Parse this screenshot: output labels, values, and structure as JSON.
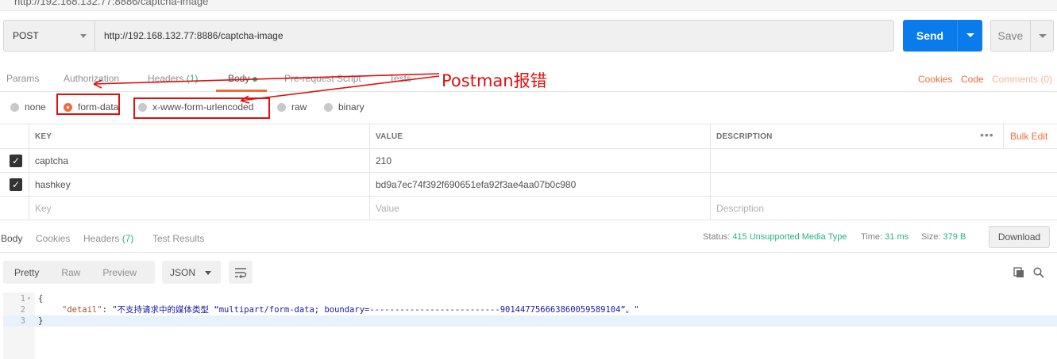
{
  "top_url": "http://192.168.132.77:8886/captcha-image",
  "request": {
    "method": "POST",
    "url": "http://192.168.132.77:8886/captcha-image",
    "send_label": "Send",
    "save_label": "Save"
  },
  "request_tabs": [
    {
      "label": "Params"
    },
    {
      "label": "Authorization"
    },
    {
      "label": "Headers",
      "count": "(1)"
    },
    {
      "label": "Body"
    },
    {
      "label": "Pre-request Script"
    },
    {
      "label": "Tests"
    }
  ],
  "request_right": {
    "cookies": "Cookies",
    "code": "Code",
    "comments": "Comments (0)"
  },
  "body_types": [
    "none",
    "form-data",
    "x-www-form-urlencoded",
    "raw",
    "binary"
  ],
  "selected_body_type": "form-data",
  "params_table": {
    "headers": [
      "KEY",
      "VALUE",
      "DESCRIPTION"
    ],
    "bulk_edit": "Bulk Edit",
    "more": "•••",
    "rows": [
      {
        "key": "captcha",
        "value": "210",
        "description": ""
      },
      {
        "key": "hashkey",
        "value": "bd9a7ec74f392f690651efa92f3ae4aa07b0c980",
        "description": ""
      }
    ],
    "placeholders": {
      "key": "Key",
      "value": "Value",
      "description": "Description"
    }
  },
  "response_tabs": [
    {
      "label": "Body"
    },
    {
      "label": "Cookies"
    },
    {
      "label": "Headers",
      "count": "(7)"
    },
    {
      "label": "Test Results"
    }
  ],
  "response_status": {
    "status_label": "Status:",
    "status_value": "415 Unsupported Media Type",
    "time_label": "Time:",
    "time_value": "31 ms",
    "size_label": "Size:",
    "size_value": "379 B",
    "download": "Download"
  },
  "view_modes": [
    "Pretty",
    "Raw",
    "Preview"
  ],
  "format": "JSON",
  "editor_lines": [
    {
      "n": "1",
      "text": "{"
    },
    {
      "n": "2",
      "key": "\"detail\"",
      "sep": ": ",
      "value": "\"不支持请求中的媒体类型 “multipart/form-data; boundary=--------------------------901447756663860059589104”。\""
    },
    {
      "n": "3",
      "text": "}"
    }
  ],
  "annotation": {
    "label": "Postman报错",
    "color": "#e01010"
  },
  "colors": {
    "accent": "#f26b3a",
    "send": "#097bed",
    "success": "#26b47f"
  }
}
